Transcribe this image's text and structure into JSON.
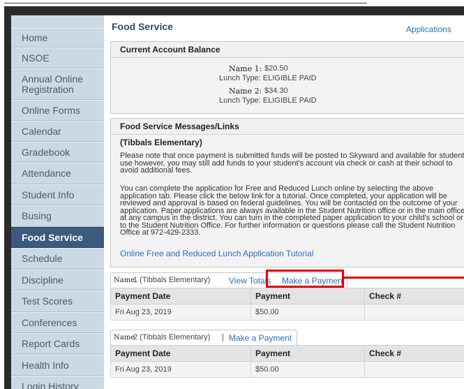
{
  "sidebar": {
    "items": [
      {
        "label": "Home",
        "active": false
      },
      {
        "label": "NSOE",
        "active": false
      },
      {
        "label": "Annual Online Registration",
        "active": false
      },
      {
        "label": "Online Forms",
        "active": false
      },
      {
        "label": "Calendar",
        "active": false
      },
      {
        "label": "Gradebook",
        "active": false
      },
      {
        "label": "Attendance",
        "active": false
      },
      {
        "label": "Student Info",
        "active": false
      },
      {
        "label": "Busing",
        "active": false
      },
      {
        "label": "Food Service",
        "active": true
      },
      {
        "label": "Schedule",
        "active": false
      },
      {
        "label": "Discipline",
        "active": false
      },
      {
        "label": "Test Scores",
        "active": false
      },
      {
        "label": "Conferences",
        "active": false
      },
      {
        "label": "Report Cards",
        "active": false
      },
      {
        "label": "Health Info",
        "active": false
      },
      {
        "label": "Login History",
        "active": false
      }
    ]
  },
  "header": {
    "title": "Food Service",
    "applications_link": "Applications"
  },
  "balance": {
    "heading": "Current Account Balance",
    "students": [
      {
        "name": "Name 1:",
        "amount": "$20.50",
        "lunch_type": "Lunch Type:  ELIGIBLE PAID"
      },
      {
        "name": "Name 2:",
        "amount": "$34.30",
        "lunch_type": "Lunch Type:  ELIGIBLE PAID"
      }
    ]
  },
  "messages": {
    "heading": "Food Service Messages/Links",
    "school": "(Tibbals Elementary)",
    "para1": "Please note that once payment is submitted funds will be posted to Skyward and available for student use however, you may still add funds to your student's account via check or cash at their school to avoid additional fees.",
    "para2": "You can complete the application for Free and Reduced Lunch online by selecting the above application tab. Please click the below link for a tutorial. Once completed, your application will be reviewed and approval is based on federal guidelines. You will be contacted on the outcome of your application. Paper applications are always available in the Student Nutrition office or in the main office at any campus in the district. You can turn in the completed paper application to your child's school or to the Student Nutrition Office. For further information or questions please call the Student Nutrition Office at 972-429-2333.",
    "tutorial_link": "Online Free and Reduced Lunch Application Tutorial"
  },
  "payments": {
    "student1": {
      "name": "Name",
      "suffix": "1 (Tibbals Elementary)",
      "view_totals": "View Totals",
      "make_payment": "Make a Payment",
      "columns": [
        "Payment Date",
        "Payment",
        "Check #"
      ],
      "rows": [
        [
          "Fri Aug 23, 2019",
          "$50.00",
          ""
        ]
      ]
    },
    "student2": {
      "name": "Name",
      "suffix": "2 (Tibbals Elementary)",
      "separator": "|",
      "make_payment": "Make a Payment",
      "columns": [
        "Payment Date",
        "Payment",
        "Check #"
      ],
      "rows": [
        [
          "Fri Aug 23, 2019",
          "$50.00",
          ""
        ]
      ]
    }
  },
  "colors": {
    "accent": "#3b5a7d",
    "highlight": "#e00000",
    "link": "#2a6ebb"
  }
}
